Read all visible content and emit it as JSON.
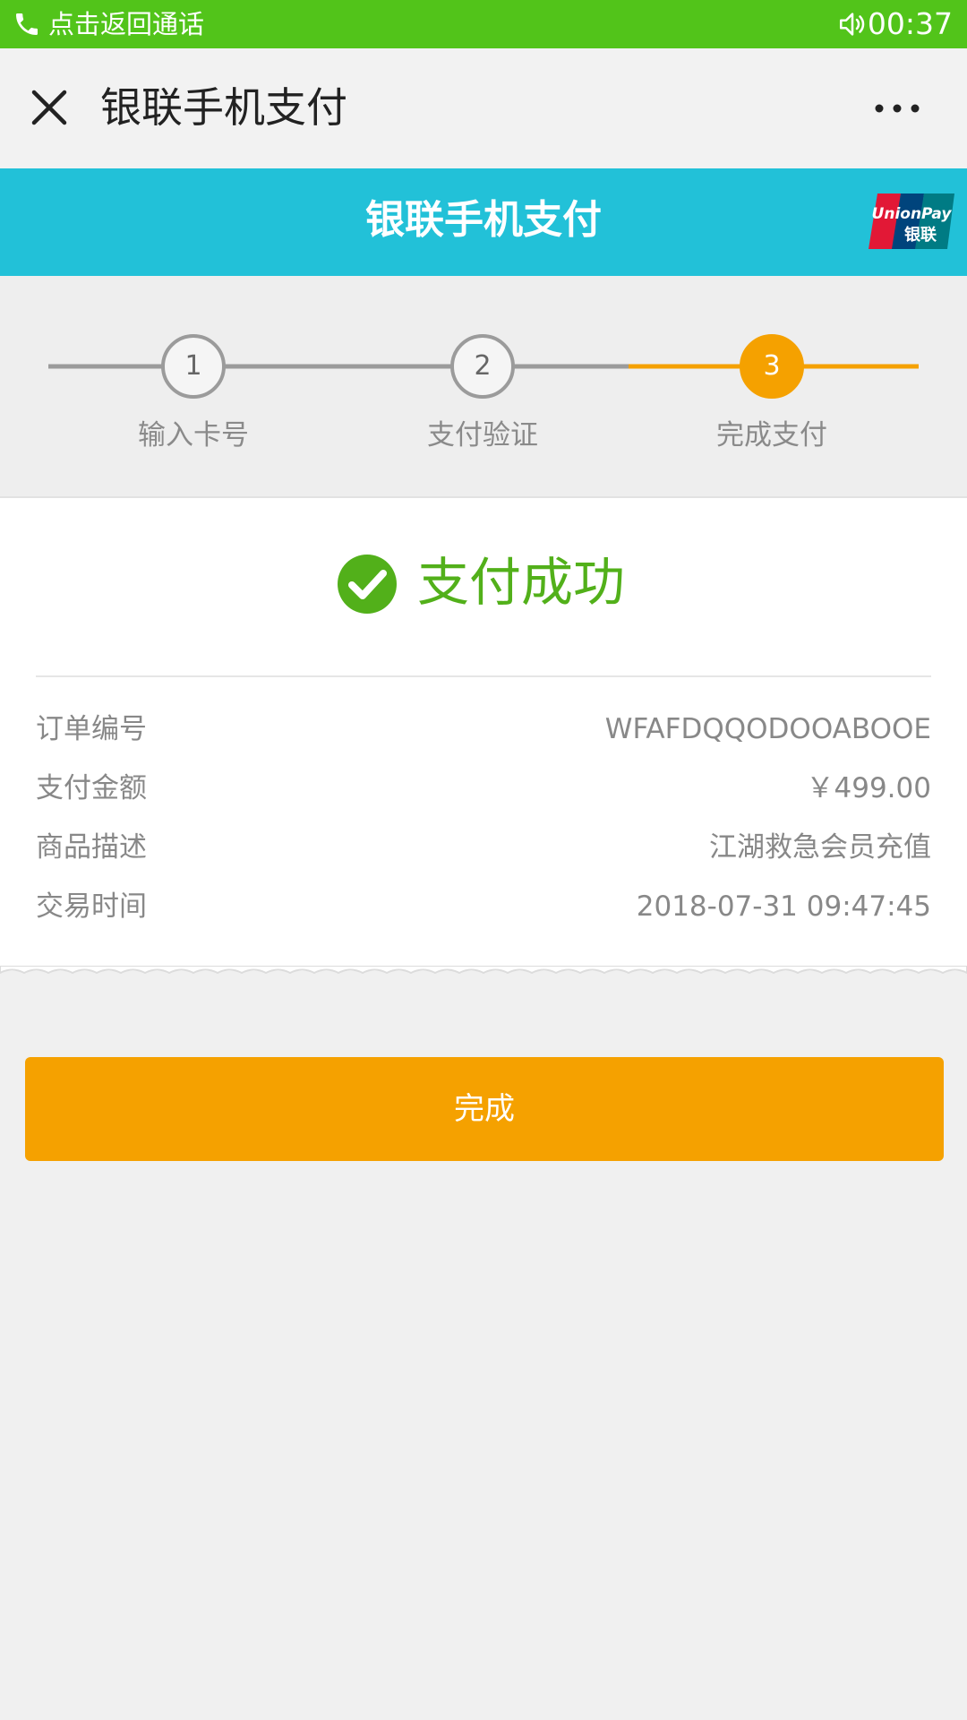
{
  "status_bar": {
    "call_text": "点击返回通话",
    "time": "00:37",
    "color": "#52c41a"
  },
  "nav": {
    "title": "银联手机支付",
    "close_icon": "close-icon",
    "more_icon": "more-icon"
  },
  "header": {
    "title": "银联手机支付",
    "logo_text_en": "UnionPay",
    "logo_text_cn": "银联",
    "color": "#22c1d8"
  },
  "steps": [
    {
      "number": "1",
      "label": "输入卡号",
      "active": false
    },
    {
      "number": "2",
      "label": "支付验证",
      "active": false
    },
    {
      "number": "3",
      "label": "完成支付",
      "active": true
    }
  ],
  "result": {
    "status_text": "支付成功",
    "success_color": "#52b01a"
  },
  "details": [
    {
      "label": "订单编号",
      "value": "WFAFDQQODOOABOOE"
    },
    {
      "label": "支付金额",
      "value": "￥499.00"
    },
    {
      "label": "商品描述",
      "value": "江湖救急会员充值"
    },
    {
      "label": "交易时间",
      "value": "2018-07-31 09:47:45"
    }
  ],
  "done_button": {
    "label": "完成",
    "color": "#f5a100"
  }
}
